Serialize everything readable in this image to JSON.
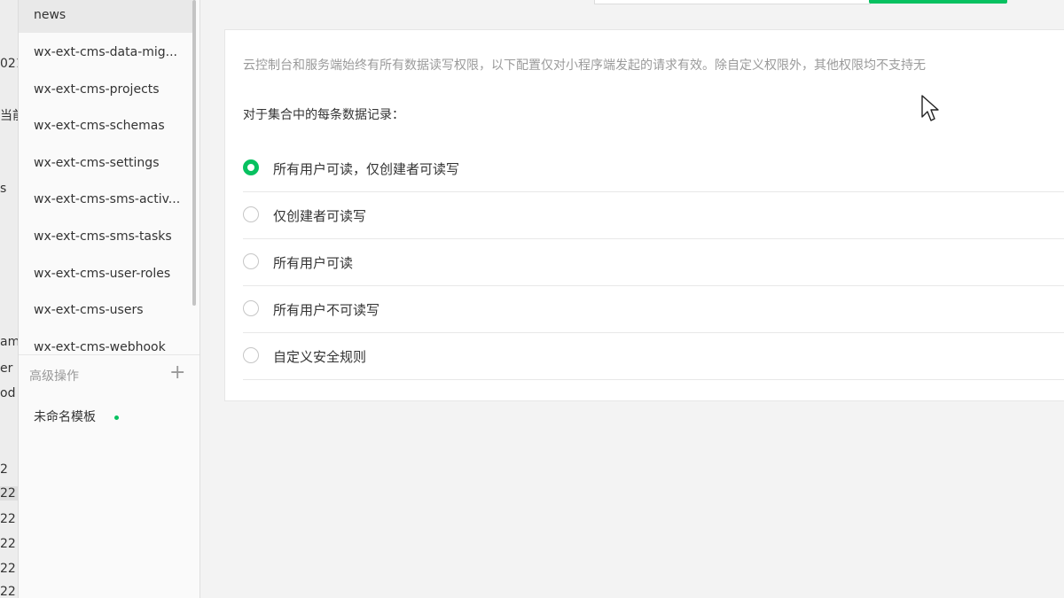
{
  "left_strip": {
    "fragments": [
      "021",
      "当前",
      "s",
      "am",
      "er",
      "od",
      "2",
      "22",
      "22",
      "22",
      "22",
      "22"
    ]
  },
  "collections": {
    "items": [
      "news",
      "wx-ext-cms-data-mig...",
      "wx-ext-cms-projects",
      "wx-ext-cms-schemas",
      "wx-ext-cms-settings",
      "wx-ext-cms-sms-activ...",
      "wx-ext-cms-sms-tasks",
      "wx-ext-cms-user-roles",
      "wx-ext-cms-users",
      "wx-ext-cms-webhook"
    ],
    "selected": "news"
  },
  "advanced": {
    "label": "高级操作",
    "add_icon": "plus-icon",
    "template_item": "未命名模板"
  },
  "permissions": {
    "description": "云控制台和服务端始终有所有数据读写权限，以下配置仅对小程序端发起的请求有效。除自定义权限外，其他权限均不支持无",
    "question": "对于集合中的每条数据记录：",
    "options": [
      "所有用户可读，仅创建者可读写",
      "仅创建者可读写",
      "所有用户可读",
      "所有用户不可读写",
      "自定义安全规则"
    ],
    "selected": "所有用户可读，仅创建者可读写"
  },
  "colors": {
    "accent": "#07c160"
  }
}
